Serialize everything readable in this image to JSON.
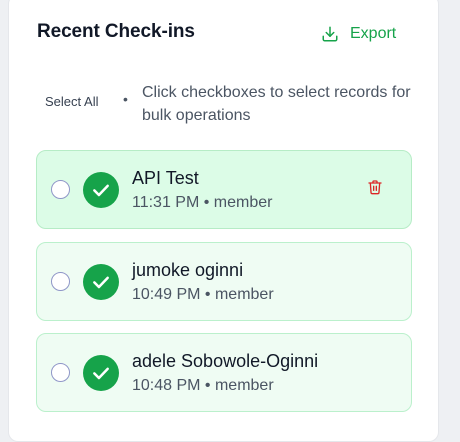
{
  "header": {
    "title": "Recent Check-ins",
    "export_label": "Export"
  },
  "bulk": {
    "select_all_label": "Select All",
    "separator": "•",
    "hint": "Click checkboxes to select records for bulk operations"
  },
  "items": [
    {
      "name": "API Test",
      "time": "11:31 PM",
      "role": "member",
      "meta": "11:31 PM • member"
    },
    {
      "name": "jumoke oginni",
      "time": "10:49 PM",
      "role": "member",
      "meta": "10:49 PM • member"
    },
    {
      "name": "adele Sobowole-Oginni",
      "time": "10:48 PM",
      "role": "member",
      "meta": "10:48 PM • member"
    }
  ],
  "colors": {
    "accent_green": "#16a34a",
    "delete_red": "#dc2626"
  },
  "icons": {
    "export": "download-icon",
    "status": "check-circle-icon",
    "delete": "trash-icon"
  }
}
